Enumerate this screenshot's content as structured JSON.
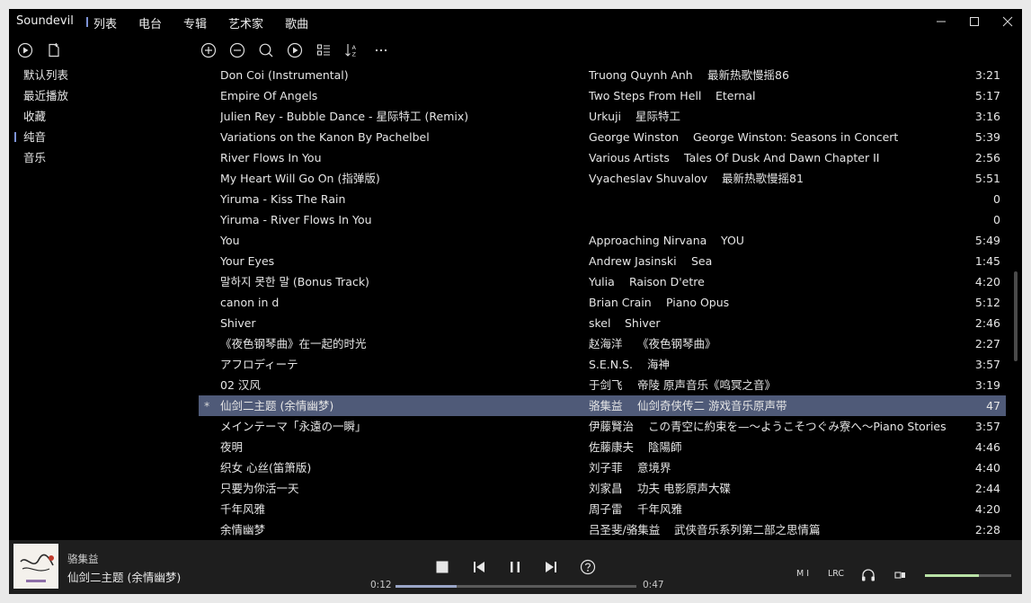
{
  "app": {
    "title": "Soundevil"
  },
  "nav": [
    "列表",
    "电台",
    "专辑",
    "艺术家",
    "歌曲"
  ],
  "sidebar": [
    "默认列表",
    "最近播放",
    "收藏",
    "纯音",
    "音乐"
  ],
  "tracks": [
    {
      "title": "Don Coi (Instrumental)",
      "artist": "Truong Quynh Anh",
      "album": "最新热歌慢摇86",
      "duration": "3:21"
    },
    {
      "title": "Empire Of Angels",
      "artist": "Two Steps From Hell",
      "album": "Eternal",
      "duration": "5:17"
    },
    {
      "title": "Julien Rey - Bubble Dance - 星际特工 (Remix)",
      "artist": "Urkuji",
      "album": "星际特工",
      "duration": "3:16"
    },
    {
      "title": "Variations on the Kanon By Pachelbel",
      "artist": "George Winston",
      "album": "George Winston: Seasons in Concert",
      "duration": "5:39"
    },
    {
      "title": "River Flows In You",
      "artist": "Various Artists",
      "album": "Tales Of Dusk And Dawn Chapter II",
      "duration": "2:56"
    },
    {
      "title": "My Heart Will Go On (指弹版)",
      "artist": "Vyacheslav Shuvalov",
      "album": "最新热歌慢摇81",
      "duration": "5:51"
    },
    {
      "title": "Yiruma - Kiss The Rain",
      "artist": "",
      "album": "",
      "duration": "0"
    },
    {
      "title": "Yiruma - River Flows In You",
      "artist": "",
      "album": "",
      "duration": "0"
    },
    {
      "title": "You",
      "artist": "Approaching Nirvana",
      "album": "YOU",
      "duration": "5:49"
    },
    {
      "title": "Your Eyes",
      "artist": "Andrew Jasinski",
      "album": "Sea",
      "duration": "1:45"
    },
    {
      "title": "말하지 못한 말 (Bonus Track)",
      "artist": "Yulia",
      "album": "Raison D'etre",
      "duration": "4:20"
    },
    {
      "title": "canon in d",
      "artist": "Brian Crain",
      "album": "Piano Opus",
      "duration": "5:12"
    },
    {
      "title": "Shiver",
      "artist": "skel",
      "album": "Shiver",
      "duration": "2:46"
    },
    {
      "title": "《夜色钢琴曲》在一起的时光",
      "artist": "赵海洋",
      "album": "《夜色钢琴曲》",
      "duration": "2:27"
    },
    {
      "title": "アフロディーテ",
      "artist": "S.E.N.S.",
      "album": "海神",
      "duration": "3:57"
    },
    {
      "title": "02 汉风",
      "artist": "于剑飞",
      "album": "帝陵 原声音乐《鸣冥之音》",
      "duration": "3:19"
    },
    {
      "title": "仙剑二主题 (余情幽梦)",
      "artist": "骆集益",
      "album": "仙剑奇侠传二 游戏音乐原声带",
      "duration": "47",
      "playing": true,
      "marker": "*"
    },
    {
      "title": "メインテーマ「永遠の一瞬」",
      "artist": "伊藤賢治",
      "album": "この青空に約束を—～ようこそつぐみ寮へ～Piano Stories",
      "duration": "3:57"
    },
    {
      "title": "夜明",
      "artist": "佐藤康夫",
      "album": "陰陽師",
      "duration": "4:46"
    },
    {
      "title": "织女 心丝(笛箫版)",
      "artist": "刘子菲",
      "album": "意境界",
      "duration": "4:40"
    },
    {
      "title": "只要为你活一天",
      "artist": "刘家昌",
      "album": "功夫 电影原声大碟",
      "duration": "2:44"
    },
    {
      "title": "千年风雅",
      "artist": "周子雷",
      "album": "千年风雅",
      "duration": "4:20"
    },
    {
      "title": "余情幽梦",
      "artist": "吕圣斐/骆集益",
      "album": "武侠音乐系列第二部之思情篇",
      "duration": "2:28"
    }
  ],
  "player": {
    "artist": "骆集益",
    "title": "仙剑二主题 (余情幽梦)",
    "elapsed": "0:12",
    "total": "0:47",
    "progress": 0.255,
    "volume": 0.62,
    "mode_label": "M I",
    "lrc_label": "LRC"
  },
  "colors": {
    "accent": "#7d93d6",
    "playing_row": "#4f5a78",
    "volume": "#b9e2a6",
    "progress": "#9aa6c8"
  }
}
